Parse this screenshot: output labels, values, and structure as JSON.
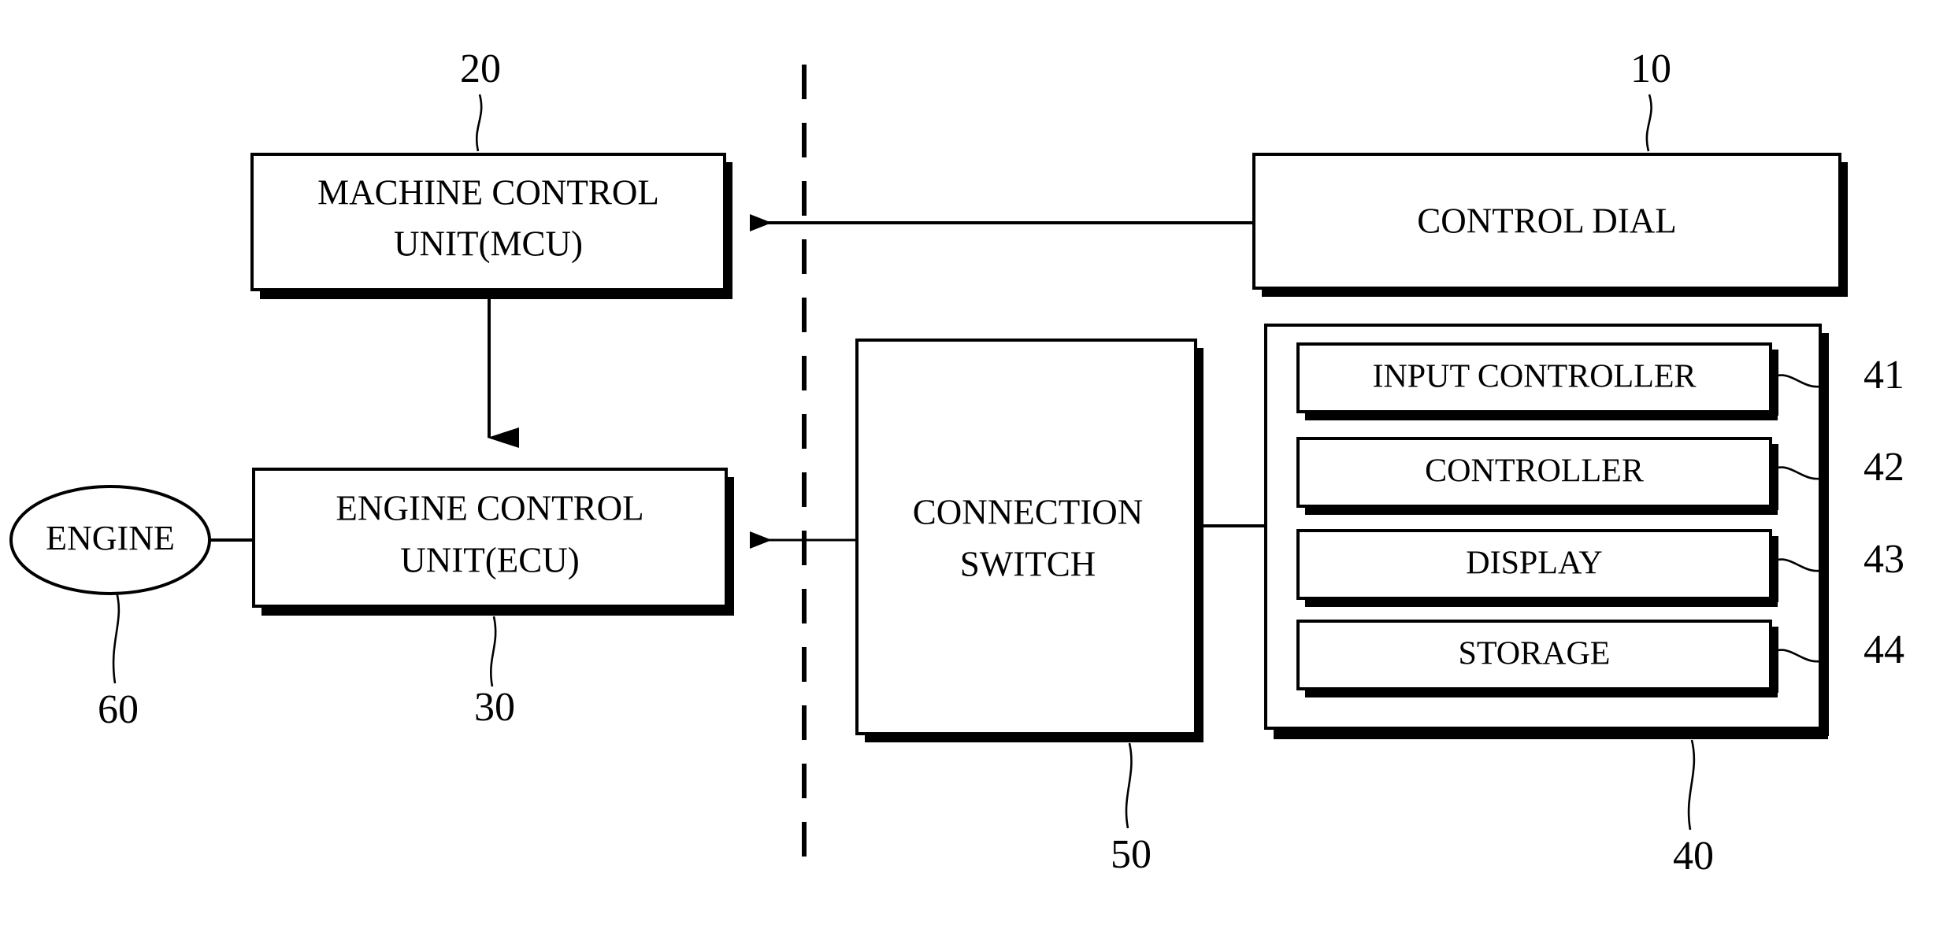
{
  "figure": {
    "type": "patent-block-diagram",
    "background_color": "#ffffff",
    "line_color": "#000000"
  },
  "blocks": {
    "machine_control_unit": {
      "line1": "MACHINE CONTROL",
      "line2": "UNIT(MCU)",
      "ref": "20"
    },
    "engine_control_unit": {
      "line1": "ENGINE CONTROL",
      "line2": "UNIT(ECU)",
      "ref": "30"
    },
    "engine": {
      "label": "ENGINE",
      "ref": "60"
    },
    "connection_switch": {
      "line1": "CONNECTION",
      "line2": "SWITCH",
      "ref": "50"
    },
    "control_dial": {
      "label": "CONTROL DIAL",
      "ref": "10"
    },
    "terminal_unit": {
      "ref": "40",
      "modules": [
        {
          "label": "INPUT CONTROLLER",
          "ref": "41"
        },
        {
          "label": "CONTROLLER",
          "ref": "42"
        },
        {
          "label": "DISPLAY",
          "ref": "43"
        },
        {
          "label": "STORAGE",
          "ref": "44"
        }
      ]
    }
  },
  "connections": [
    {
      "name": "control-dial-to-mcu",
      "from": "control_dial",
      "to": "machine_control_unit",
      "arrow": "to"
    },
    {
      "name": "mcu-to-ecu",
      "from": "machine_control_unit",
      "to": "engine_control_unit",
      "arrow": "to"
    },
    {
      "name": "connection-switch-to-ecu",
      "from": "connection_switch",
      "to": "engine_control_unit",
      "arrow": "to"
    },
    {
      "name": "terminal-unit-to-connection-switch",
      "from": "terminal_unit",
      "to": "connection_switch",
      "arrow": "none"
    },
    {
      "name": "engine-to-ecu",
      "from": "engine",
      "to": "engine_control_unit",
      "arrow": "none"
    }
  ],
  "divider": {
    "name": "vertical-dashed-separator",
    "style": "dashed"
  }
}
